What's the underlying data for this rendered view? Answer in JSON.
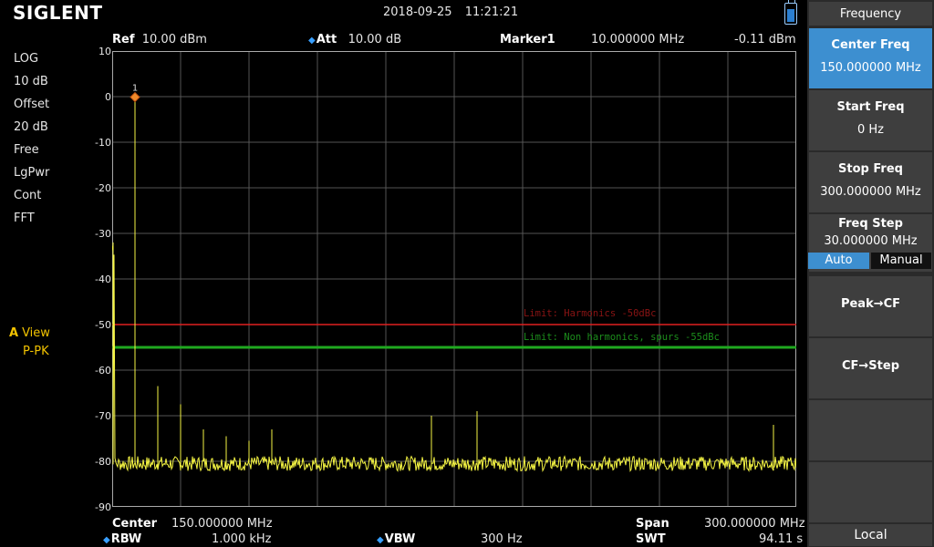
{
  "brand": "SIGLENT",
  "datetime": {
    "date": "2018-09-25",
    "time": "11:21:21"
  },
  "header": {
    "ref_label": "Ref",
    "ref_value": "10.00 dBm",
    "att_label": "Att",
    "att_value": "10.00 dB",
    "marker_label": "Marker1",
    "marker_freq": "10.000000 MHz",
    "marker_level": "-0.11 dBm"
  },
  "left_settings": [
    "LOG",
    "10 dB",
    "Offset",
    "20 dB",
    "Free",
    "LgPwr",
    "Cont",
    "FFT"
  ],
  "trace": {
    "id": "A",
    "label": "View",
    "detector": "P-PK"
  },
  "y_axis": [
    "10",
    "0",
    "-10",
    "-20",
    "-30",
    "-40",
    "-50",
    "-60",
    "-70",
    "-80",
    "-90"
  ],
  "marker_number": "1",
  "limits": {
    "harmonics": {
      "label": "Limit: Harmonics -50dBc",
      "level_dbm": -50,
      "color": "#e02020"
    },
    "spurs": {
      "label": "Limit: Non harmonics, spurs -55dBc",
      "level_dbm": -55,
      "color": "#1fa81f"
    }
  },
  "trace_color": "#f5f543",
  "spectrum": {
    "start_mhz": 0,
    "stop_mhz": 300,
    "ref_dbm": 10,
    "bottom_dbm": -90,
    "noise_floor_dbm": -80.5,
    "peaks": [
      {
        "mhz": 10,
        "dbm": -0.11
      },
      {
        "mhz": 0.5,
        "dbm": -32
      },
      {
        "mhz": 20,
        "dbm": -63.5
      },
      {
        "mhz": 30,
        "dbm": -67.5
      },
      {
        "mhz": 40,
        "dbm": -73
      },
      {
        "mhz": 50,
        "dbm": -74.5
      },
      {
        "mhz": 60,
        "dbm": -75.5
      },
      {
        "mhz": 70,
        "dbm": -73
      },
      {
        "mhz": 140,
        "dbm": -70
      },
      {
        "mhz": 160,
        "dbm": -69
      },
      {
        "mhz": 290,
        "dbm": -72
      }
    ]
  },
  "footer": {
    "center_label": "Center",
    "center_value": "150.000000 MHz",
    "span_label": "Span",
    "span_value": "300.000000 MHz",
    "rbw_label": "RBW",
    "rbw_value": "1.000 kHz",
    "vbw_label": "VBW",
    "vbw_value": "300 Hz",
    "swt_label": "SWT",
    "swt_value": "94.11 s"
  },
  "menu": {
    "title": "Frequency",
    "center_freq": {
      "label": "Center Freq",
      "value": "150.000000 MHz"
    },
    "start_freq": {
      "label": "Start Freq",
      "value": "0 Hz"
    },
    "stop_freq": {
      "label": "Stop Freq",
      "value": "300.000000 MHz"
    },
    "freq_step": {
      "label": "Freq Step",
      "value": "30.000000 MHz",
      "auto": "Auto",
      "manual": "Manual"
    },
    "peak_cf": "Peak→CF",
    "cf_step": "CF→Step",
    "local": "Local"
  }
}
